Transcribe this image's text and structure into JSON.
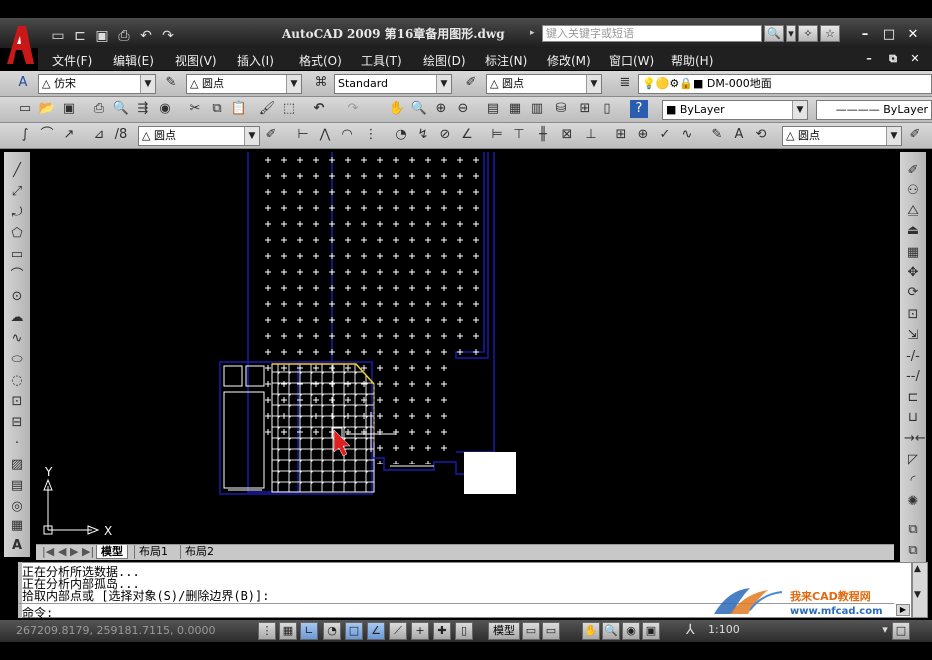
{
  "window": {
    "title": "AutoCAD  2009  第16章备用图形.dwg",
    "search_placeholder": "键入关键字或短语"
  },
  "menu": [
    "文件(F)",
    "编辑(E)",
    "视图(V)",
    "插入(I)",
    "格式(O)",
    "工具(T)",
    "绘图(D)",
    "标注(N)",
    "修改(M)",
    "窗口(W)",
    "帮助(H)"
  ],
  "toolbars": {
    "text_style_font": "仿宋",
    "dim_style": "圆点",
    "text_style": "Standard",
    "multileader_style": "圆点",
    "layer_name": "DM-000地面",
    "color": "ByLayer",
    "linetype": "ByLayer",
    "dim_style_2": "圆点",
    "dim_style_3": "圆点"
  },
  "layout_tabs": [
    "模型",
    "布局1",
    "布局2"
  ],
  "command": {
    "lines": [
      "正在分析所选数据...",
      "正在分析内部孤岛...",
      "拾取内部点或 [选择对象(S)/删除边界(B)]:"
    ],
    "prompt": "命令:"
  },
  "status": {
    "coordinates": "267209.8179,  259181.7115,  0.0000",
    "model_label": "模型",
    "annotation_scale": "1:100"
  },
  "ucs": {
    "x_label": "X",
    "y_label": "Y"
  },
  "watermark": {
    "brand": "我来CAD教程网",
    "url": "www.mfcad.com"
  },
  "colors": {
    "canvas_bg": "#000000",
    "boundary": "#1a1aa8",
    "hatch": "#ffffff",
    "highlight": "#f0d020",
    "cursor": "#e02020"
  }
}
